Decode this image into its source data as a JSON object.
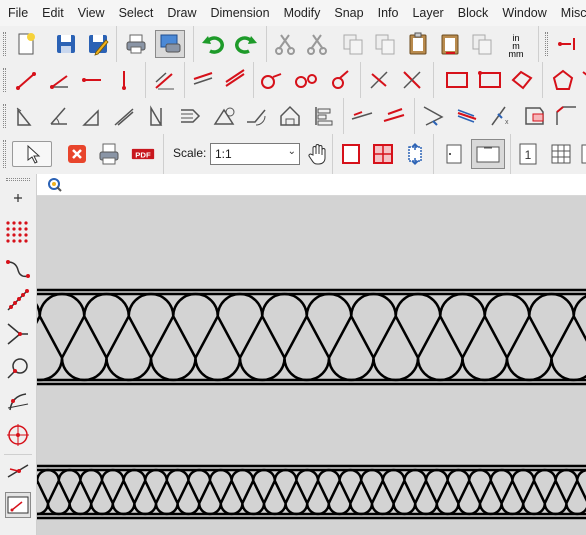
{
  "menubar": {
    "items": [
      "File",
      "Edit",
      "View",
      "Select",
      "Draw",
      "Dimension",
      "Modify",
      "Snap",
      "Info",
      "Layer",
      "Block",
      "Window",
      "Misc"
    ]
  },
  "toolbar4": {
    "scale_label": "Scale:",
    "scale_value": "1:1",
    "pdf_label": "PDF",
    "units_label": "in\nmm",
    "page_number": "1"
  },
  "icons": {
    "new": "new-document-icon",
    "save": "save-icon",
    "save_as": "save-as-icon",
    "print": "print-icon",
    "print_preview": "print-preview-icon",
    "undo": "undo-icon",
    "redo": "redo-icon",
    "cut": "cut-icon",
    "copy": "copy-icon"
  },
  "colors": {
    "accent_red": "#d6111a",
    "canvas_bg": "#d3d3d3",
    "drawing_stroke": "#000000"
  }
}
